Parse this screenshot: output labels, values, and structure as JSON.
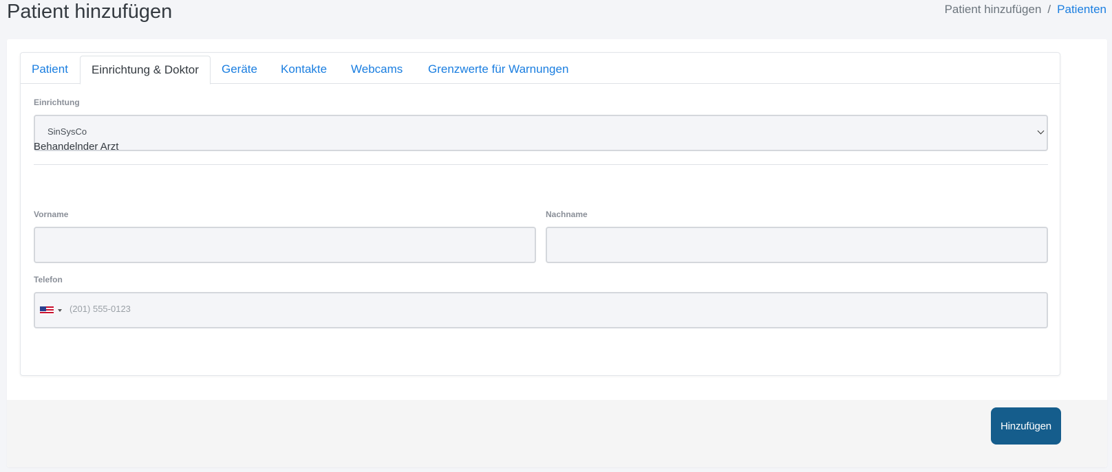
{
  "header": {
    "title": "Patient hinzufügen",
    "breadcrumb": {
      "current": "Patient hinzufügen",
      "separator": "/",
      "link": "Patienten"
    }
  },
  "tabs": [
    {
      "label": "Patient",
      "active": false
    },
    {
      "label": "Einrichtung & Doktor",
      "active": true
    },
    {
      "label": "Geräte",
      "active": false
    },
    {
      "label": "Kontakte",
      "active": false
    },
    {
      "label": "Webcams",
      "active": false
    },
    {
      "label": "Grenzwerte für Warnungen",
      "active": false
    }
  ],
  "form": {
    "facility": {
      "label": "Einrichtung",
      "selected": "SinSysCo"
    },
    "doctor_section": {
      "title": "Behandelnder Arzt"
    },
    "first_name": {
      "label": "Vorname",
      "value": ""
    },
    "last_name": {
      "label": "Nachname",
      "value": ""
    },
    "phone": {
      "label": "Telefon",
      "placeholder": "(201) 555-0123",
      "country_flag": "us-flag-icon",
      "value": ""
    }
  },
  "footer": {
    "submit_label": "Hinzufügen"
  },
  "colors": {
    "link": "#1a7ee0",
    "primary_button": "#155d8c",
    "field_background": "#f4f5f8"
  }
}
